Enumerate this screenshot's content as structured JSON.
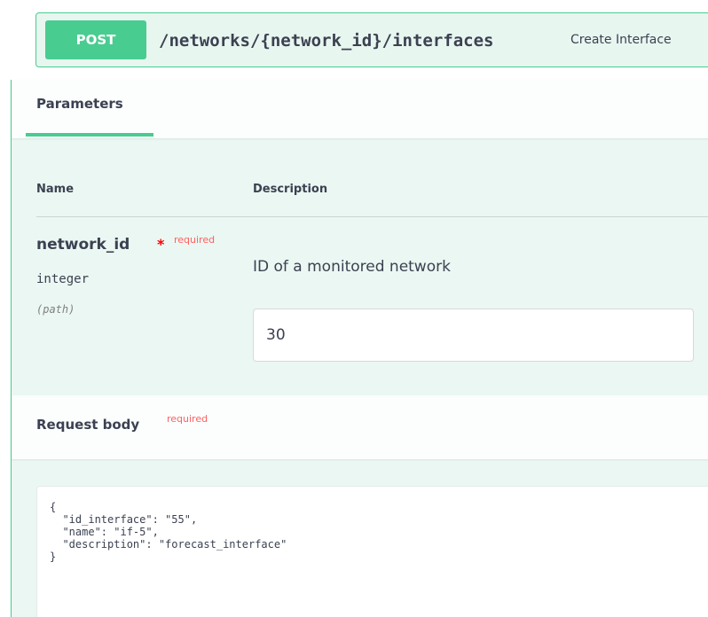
{
  "operation": {
    "method": "POST",
    "path": "/networks/{network_id}/interfaces",
    "summary": "Create Interface"
  },
  "parameters": {
    "tab_label": "Parameters",
    "columns": {
      "name": "Name",
      "description": "Description"
    },
    "items": [
      {
        "name": "network_id",
        "required_star": "*",
        "required_label": "required",
        "type": "integer",
        "in": "(path)",
        "description": "ID of a monitored network",
        "value": "30"
      }
    ]
  },
  "request_body": {
    "title": "Request body",
    "required_label": "required",
    "content": "{\n  \"id_interface\": \"55\",\n  \"name\": \"if-5\",\n  \"description\": \"forecast_interface\"\n}"
  },
  "colors": {
    "accent": "#49cc90",
    "method_bg": "#49cc90",
    "section_bg": "#ebf7f2",
    "required": "#ff0000"
  }
}
